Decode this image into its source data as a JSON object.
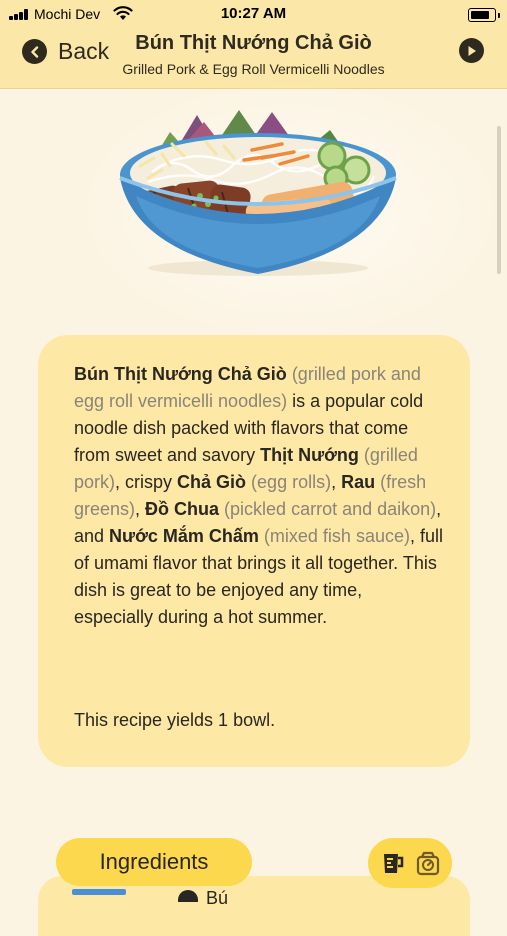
{
  "status_bar": {
    "carrier": "Mochi Dev",
    "time": "10:27 AM",
    "battery_level": 0.9
  },
  "navbar": {
    "back_label": "Back",
    "title": "Bún Thịt Nướng Chả Giò",
    "subtitle": "Grilled Pork & Egg Roll Vermicelli Noodles",
    "icons": {
      "back": "chevron-left-icon",
      "play": "play-icon"
    }
  },
  "description": {
    "segments": [
      {
        "text": "Bún Thịt Nướng Chả Giò",
        "style": "bold"
      },
      {
        "text": " (grilled pork and egg roll vermicelli noodles)",
        "style": "gray"
      },
      {
        "text": " is a popular cold noodle dish packed with flavors that come from sweet and savory ",
        "style": "normal"
      },
      {
        "text": "Thịt Nướng",
        "style": "bold"
      },
      {
        "text": " (grilled pork)",
        "style": "gray"
      },
      {
        "text": ", crispy ",
        "style": "normal"
      },
      {
        "text": "Chả Giò",
        "style": "bold"
      },
      {
        "text": " (egg rolls)",
        "style": "gray"
      },
      {
        "text": ", ",
        "style": "normal"
      },
      {
        "text": "Rau",
        "style": "bold"
      },
      {
        "text": " (fresh greens)",
        "style": "gray"
      },
      {
        "text": ", ",
        "style": "normal"
      },
      {
        "text": "Đồ Chua",
        "style": "bold"
      },
      {
        "text": " (pickled carrot and daikon)",
        "style": "gray"
      },
      {
        "text": ", and ",
        "style": "normal"
      },
      {
        "text": "Nước Mắm Chấm",
        "style": "bold"
      },
      {
        "text": " (mixed fish sauce)",
        "style": "gray"
      },
      {
        "text": ", full of umami flavor that brings it all together. This dish is great to be enjoyed any time, especially during a hot summer.",
        "style": "normal"
      }
    ],
    "yield_text": "This recipe yields 1 bowl."
  },
  "ingredients": {
    "tab_label": "Ingredients",
    "first_item_partial": "Bú",
    "tool_icons": [
      "measuring-cup-icon",
      "kitchen-scale-icon"
    ]
  },
  "colors": {
    "header_bg": "#fbe7a7",
    "page_bg": "#fcf4e3",
    "card_bg": "#fde8a6",
    "accent": "#fcd84f",
    "text": "#2a2620",
    "muted": "#8a8478"
  }
}
